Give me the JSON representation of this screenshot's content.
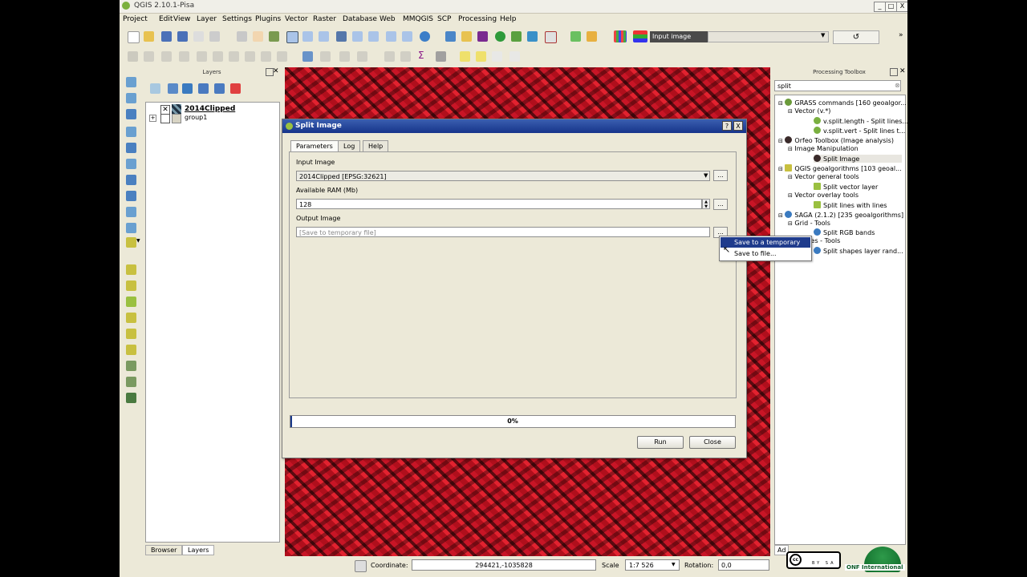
{
  "window": {
    "title": "QGIS 2.10.1-Pisa",
    "controls": [
      "_",
      "□",
      "X"
    ]
  },
  "menu": [
    "Project",
    "Edit",
    "View",
    "Layer",
    "Settings",
    "Plugins",
    "Vector",
    "Raster",
    "Database",
    "Web",
    "MMQGIS",
    "SCP",
    "Processing",
    "Help"
  ],
  "toolbar": {
    "scp_input_label": "Input image",
    "refresh_symbol": "↺"
  },
  "layers_panel": {
    "title": "Layers",
    "items": [
      {
        "name": "2014Clipped",
        "checked": true
      },
      {
        "name": "group1",
        "checked": false
      }
    ],
    "tabs": [
      "Browser",
      "Layers"
    ]
  },
  "processing_toolbox": {
    "title": "Processing Toolbox",
    "search": "split",
    "tree": [
      "GRASS commands [160 geoalgor...",
      "Vector (v.*)",
      "v.split.length - Split lines...",
      "v.split.vert - Split lines t...",
      "Orfeo Toolbox (Image analysis)",
      "Image Manipulation",
      "Split Image",
      "QGIS geoalgorithms [103 geoal...",
      "Vector general tools",
      "Split vector layer",
      "Vector overlay tools",
      "Split lines with lines",
      "SAGA (2.1.2) [235 geoalgorithms]",
      "Grid - Tools",
      "Split RGB bands",
      "Shapes - Tools",
      "Split shapes layer rand..."
    ],
    "bottom_tab": "Ad"
  },
  "dialog": {
    "title": "Split Image",
    "help_btn": "?",
    "close_btn": "X",
    "tabs": [
      "Parameters",
      "Log",
      "Help"
    ],
    "input_image_label": "Input Image",
    "input_image_value": "2014Clipped [EPSG:32621]",
    "ram_label": "Available RAM (Mb)",
    "ram_value": "128",
    "output_label": "Output Image",
    "output_placeholder": "[Save to temporary file]",
    "dots": "...",
    "progress_text": "0%",
    "progress_fraction": 0.0,
    "run": "Run",
    "close": "Close"
  },
  "popup_menu": [
    "Save to a temporary file",
    "Save to file..."
  ],
  "statusbar": {
    "coordinate_label": "Coordinate:",
    "coordinate_value": "294421,-1035828",
    "scale_label": "Scale",
    "scale_value": "1:7 526",
    "rotation_label": "Rotation:",
    "rotation_value": "0,0"
  },
  "watermark": {
    "license": "BY SA",
    "org": "ONF International"
  }
}
